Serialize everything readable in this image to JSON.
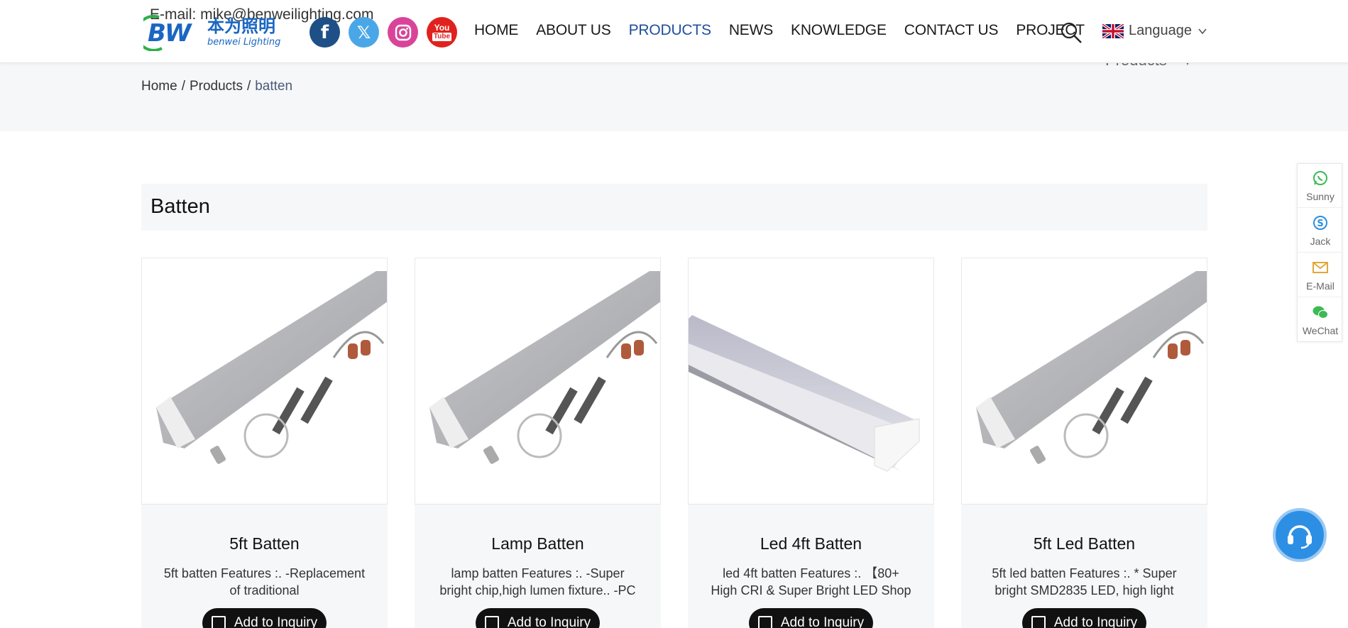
{
  "header": {
    "email": "E-mail: mike@benweilighting.com",
    "logo_text_main": "本为照明",
    "logo_text_sub": "benwei Lighting",
    "logo_mark": "BW",
    "social": [
      {
        "name": "facebook",
        "glyph": "f"
      },
      {
        "name": "x",
        "glyph": "𝕏"
      },
      {
        "name": "instagram",
        "glyph": "instagram-icon"
      },
      {
        "name": "youtube",
        "glyph_top": "You",
        "glyph_bottom": "Tube"
      }
    ],
    "nav": [
      {
        "label": "HOME",
        "active": false
      },
      {
        "label": "ABOUT US",
        "active": false
      },
      {
        "label": "PRODUCTS",
        "active": true
      },
      {
        "label": "NEWS",
        "active": false
      },
      {
        "label": "KNOWLEDGE",
        "active": false
      },
      {
        "label": "CONTACT US",
        "active": false
      },
      {
        "label": "PROJECT",
        "active": false
      }
    ],
    "language_label": "Language",
    "ghost_products": "Products"
  },
  "breadcrumb": {
    "items": [
      "Home",
      "Products",
      "batten"
    ],
    "separator": "/"
  },
  "page_title": "Batten",
  "products": [
    {
      "name": "5ft Batten",
      "desc": "5ft batten Features :. -Replacement of traditional",
      "button": "Add to Inquiry",
      "image": "batten-kit"
    },
    {
      "name": "Lamp Batten",
      "desc": "lamp batten Features :. -Super bright chip,high lumen fixture.. -PC",
      "button": "Add to Inquiry",
      "image": "batten-kit"
    },
    {
      "name": "Led 4ft Batten",
      "desc": "led 4ft batten Features :. 【80+ High CRI & Super Bright LED Shop",
      "button": "Add to Inquiry",
      "image": "batten-closeup"
    },
    {
      "name": "5ft Led Batten",
      "desc": "5ft led batten Features :. * Super bright SMD2835 LED, high light",
      "button": "Add to Inquiry",
      "image": "batten-kit"
    }
  ],
  "sidebar": [
    {
      "label": "Sunny",
      "icon": "whatsapp-icon",
      "color": "#3cba54"
    },
    {
      "label": "Jack",
      "icon": "skype-icon",
      "color": "#2b8fe0"
    },
    {
      "label": "E-Mail",
      "icon": "mail-icon",
      "color": "#e2a73a"
    },
    {
      "label": "WeChat",
      "icon": "wechat-icon",
      "color": "#3cba54"
    }
  ],
  "colors": {
    "brand_blue": "#1e4f9e",
    "band_bg": "#f6f7f8",
    "support_blue": "#2d8fe4"
  }
}
